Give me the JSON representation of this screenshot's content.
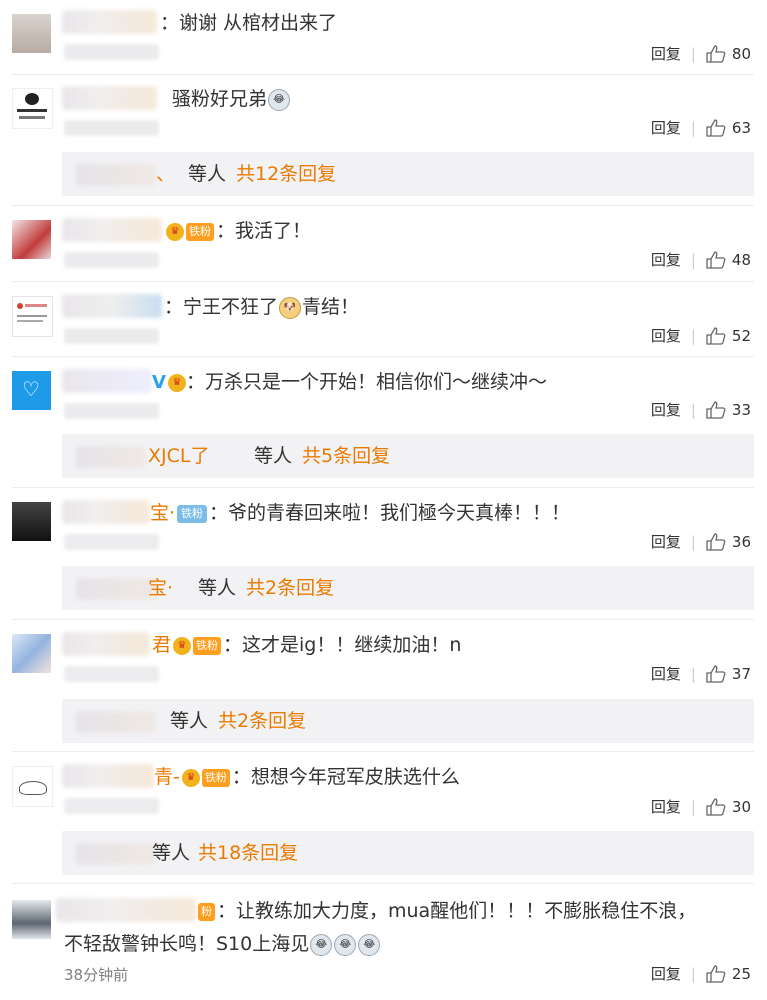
{
  "comments": [
    {
      "text": "：谢谢 从棺材出来了",
      "reply": "回复",
      "likes": "80",
      "avatar": "girl-avatar"
    },
    {
      "text": "骚粉好兄弟",
      "reply": "回复",
      "likes": "63",
      "avatar": "invictus-gaming-logo"
    },
    {
      "text": "：我活了！",
      "badge": "铁粉",
      "reply": "回复",
      "likes": "48",
      "avatar": "red-hair-avatar"
    },
    {
      "text": "：宁王不狂了",
      "text2": "青结！",
      "reply": "回复",
      "likes": "52",
      "avatar": "notice-avatar"
    },
    {
      "text": "：万杀只是一个开始！相信你们～继续冲～",
      "reply": "回复",
      "likes": "33",
      "avatar": "heart-logo-avatar"
    },
    {
      "text": "：爷的青春回来啦！我们極今天真棒！！！",
      "name_tail": "宝·",
      "badge": "铁粉",
      "reply": "回复",
      "likes": "36",
      "avatar": "team-photo-avatar"
    },
    {
      "text": "：这才是ig！！继续加油！n",
      "name_tail": "君",
      "badge": "铁粉",
      "reply": "回复",
      "likes": "37",
      "avatar": "anime-avatar"
    },
    {
      "text": "：想想今年冠军皮肤选什么",
      "name_tail": "青-",
      "badge": "铁粉",
      "reply": "回复",
      "likes": "30",
      "avatar": "cat-sketch-avatar"
    },
    {
      "text": "：让教练加大力度，mua醒他们！！！不膨胀稳住不浪，",
      "text2": "不轻敌警钟长鸣！S10上海见",
      "name_tail": "粉",
      "reply": "回复",
      "likes": "25",
      "timestamp": "38分钟前",
      "avatar": "husky-avatar"
    }
  ],
  "reply_boxes": [
    {
      "prefix": "、",
      "others": "等人",
      "total": "共12条回复"
    },
    {
      "prefix": "XJCL了",
      "others": "等人",
      "total": "共5条回复"
    },
    {
      "prefix": "宝·",
      "others": "等人",
      "total": "共2条回复"
    },
    {
      "prefix": "",
      "others": "等人",
      "total": "共2条回复"
    },
    {
      "prefix": "",
      "others": "等人",
      "total": "共18条回复"
    }
  ],
  "colors": {
    "accent": "#eb7a00",
    "badge_fan": "#ff9f1f",
    "badge_iron": "#7cbde8",
    "background": "#ffffff",
    "reply_bg": "#f2f2f5"
  }
}
